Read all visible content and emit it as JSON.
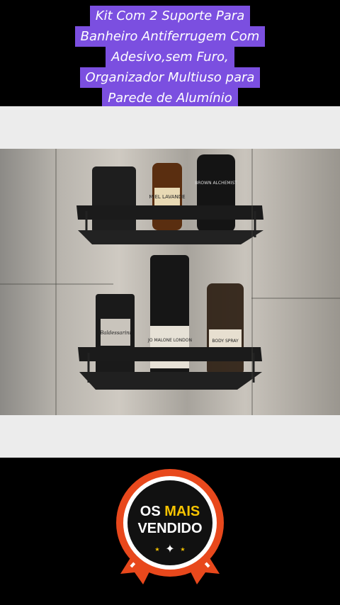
{
  "caption": {
    "lines": [
      "Kit Com 2 Suporte Para",
      "Banheiro Antiferrugem Com",
      "Adesivo,sem Furo,",
      "Organizador Multiuso para",
      "Parede de Alumínio"
    ]
  },
  "photo": {
    "bottles": {
      "top_left_label": "MIEL LAVANDE",
      "top_right_label": "BROWN ALCHEMIST",
      "bottom_left_label": "Baldessarini",
      "bottom_middle_label": "JO MALONE LONDON",
      "bottom_right_label": "BODY SPRAY"
    }
  },
  "badge": {
    "line1_a": "OS ",
    "line1_b": "MAIS",
    "line2": "VENDIDO",
    "colors": {
      "ring": "#e8481c",
      "inner": "#111111",
      "highlight": "#f7c400",
      "ribbon": "#e8481c"
    }
  }
}
